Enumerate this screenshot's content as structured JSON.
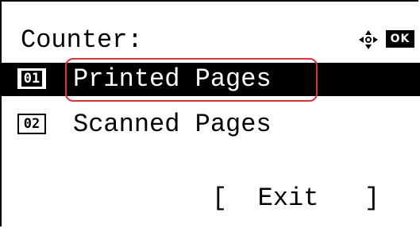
{
  "screen": {
    "title": "Counter:",
    "icons": {
      "nav": "four-way-arrow-icon",
      "ok": "OK"
    }
  },
  "menu": {
    "items": [
      {
        "number": "01",
        "label": "Printed Pages",
        "selected": true
      },
      {
        "number": "02",
        "label": "Scanned Pages",
        "selected": false
      }
    ]
  },
  "softkey": {
    "label": "[  Exit   ]"
  },
  "colors": {
    "background": "#ffffff",
    "foreground": "#000000",
    "highlight": "#d9343b"
  }
}
